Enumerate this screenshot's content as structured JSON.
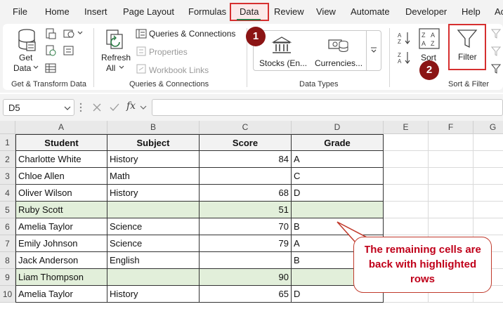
{
  "menu": {
    "items": [
      {
        "key": "file",
        "label": "File"
      },
      {
        "key": "home",
        "label": "Home"
      },
      {
        "key": "insert",
        "label": "Insert"
      },
      {
        "key": "page-layout",
        "label": "Page Layout"
      },
      {
        "key": "formulas",
        "label": "Formulas"
      },
      {
        "key": "data",
        "label": "Data"
      },
      {
        "key": "review",
        "label": "Review"
      },
      {
        "key": "view",
        "label": "View"
      },
      {
        "key": "automate",
        "label": "Automate"
      },
      {
        "key": "developer",
        "label": "Developer"
      },
      {
        "key": "help",
        "label": "Help"
      },
      {
        "key": "acrobat",
        "label": "Ac"
      }
    ],
    "active": "Data"
  },
  "ribbon": {
    "get_data_label": "Get",
    "get_data_label2": "Data",
    "group_get_transform": "Get & Transform Data",
    "refresh_label": "Refresh",
    "refresh_label2": "All",
    "queries_connections": "Queries & Connections",
    "properties": "Properties",
    "workbook_links": "Workbook Links",
    "group_queries": "Queries & Connections",
    "stocks": "Stocks (En...",
    "currencies": "Currencies...",
    "group_data_types": "Data Types",
    "sort": "Sort",
    "filter": "Filter",
    "group_sort_filter": "Sort & Filter"
  },
  "badges": {
    "one": "1",
    "two": "2"
  },
  "formula_bar": {
    "name_box": "D5",
    "fx": "fx",
    "formula": ""
  },
  "columns": [
    "A",
    "B",
    "C",
    "D",
    "E",
    "F",
    "G"
  ],
  "rows": [
    "1",
    "2",
    "3",
    "4",
    "5",
    "6",
    "7",
    "8",
    "9",
    "10"
  ],
  "table": {
    "headers": [
      "Student",
      "Subject",
      "Score",
      "Grade"
    ],
    "rows": [
      [
        "Charlotte White",
        "History",
        "84",
        "A"
      ],
      [
        "Chloe Allen",
        "Math",
        "",
        "C"
      ],
      [
        "Oliver Wilson",
        "History",
        "68",
        "D"
      ],
      [
        "Ruby Scott",
        "",
        "51",
        ""
      ],
      [
        "Amelia Taylor",
        "Science",
        "70",
        "B"
      ],
      [
        "Emily Johnson",
        "Science",
        "79",
        "A"
      ],
      [
        "Jack Anderson",
        "English",
        "",
        "B"
      ],
      [
        "Liam Thompson",
        "",
        "90",
        ""
      ],
      [
        "Amelia Taylor",
        "History",
        "65",
        "D"
      ]
    ],
    "highlighted_rows": [
      5,
      9
    ],
    "highlight_color": "#e2efda"
  },
  "callout": {
    "line1": "The remaining cells are",
    "line2": "back with highlighted",
    "line3": "rows"
  },
  "colors": {
    "accent_red": "#d62f2f",
    "badge": "#8b1414",
    "excel_green": "#2a7a43"
  }
}
